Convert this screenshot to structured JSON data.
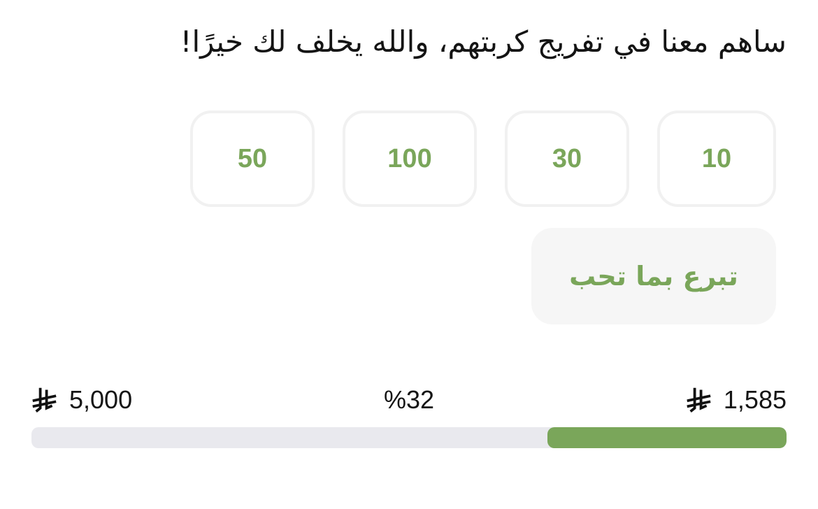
{
  "headline": "ساهم معنا في تفريج كربتهم، والله يخلف لك خيرًا!",
  "amount_options": [
    "10",
    "30",
    "100",
    "50"
  ],
  "custom_amount_label": "تبرع بما تحب",
  "progress": {
    "raised": "1,585",
    "goal": "5,000",
    "percent_label": "%32",
    "fraction": 0.317
  },
  "currency_icon": "saudi-riyal-icon",
  "colors": {
    "accent": "#7aa65a",
    "track": "#e9e9ee",
    "border": "#f1f1f1",
    "custom_bg": "#f6f6f6"
  }
}
